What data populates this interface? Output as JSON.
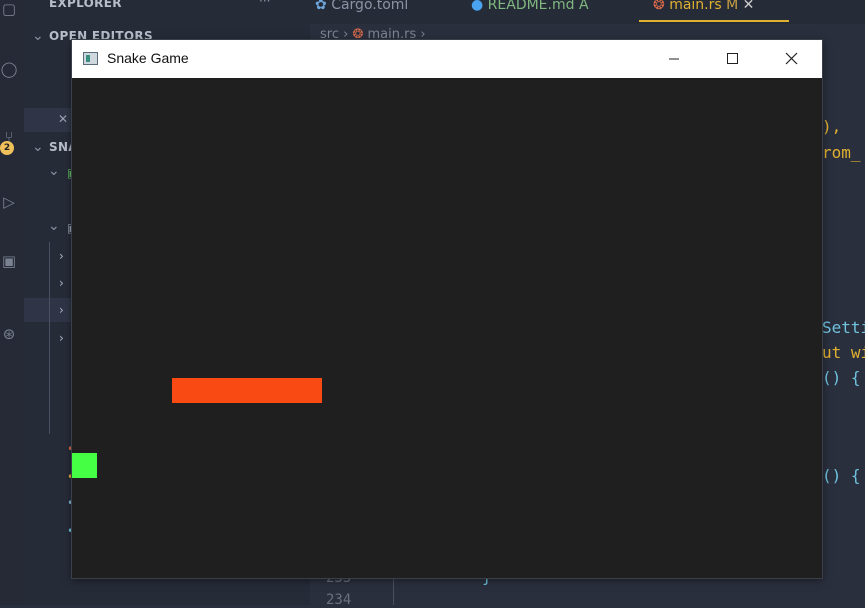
{
  "vscode": {
    "sidebar": {
      "explorer_title": "EXPLORER",
      "open_editors": "OPEN EDITORS",
      "project_folder": "SNA",
      "badge_count": "2"
    },
    "tabs": [
      {
        "label": "Cargo.toml",
        "icon": "gear-icon",
        "color": "#8b93a6"
      },
      {
        "label": "README.md",
        "status": "A",
        "icon": "info-icon",
        "color": "#7fb77f"
      },
      {
        "label": "main.rs",
        "status": "M",
        "icon": "rust-icon",
        "color": "#e0b030",
        "active": true
      }
    ],
    "breadcrumb": {
      "folder": "src",
      "file": "main.rs"
    },
    "code_fragments": [
      {
        "text": "),",
        "color": "#e0b030"
      },
      {
        "text": "rom_",
        "color": "#e0b030"
      },
      {
        "text": "Setti",
        "color": "#6fc3df"
      },
      {
        "text": "ut wi",
        "color": "#e0b030"
      },
      {
        "text": "() {",
        "color": "#6fc3df"
      },
      {
        "text": "() {",
        "color": "#6fc3df"
      },
      {
        "text": "}",
        "color": "#6fc3df"
      }
    ],
    "line_numbers": [
      "233",
      "234"
    ]
  },
  "window": {
    "title": "Snake Game",
    "minimize_label": "—",
    "maximize_label": "☐",
    "close_label": "✕"
  },
  "game": {
    "background_color": "#1f1f1f",
    "snake_color": "#fa4a14",
    "food_color": "#44ff44"
  }
}
